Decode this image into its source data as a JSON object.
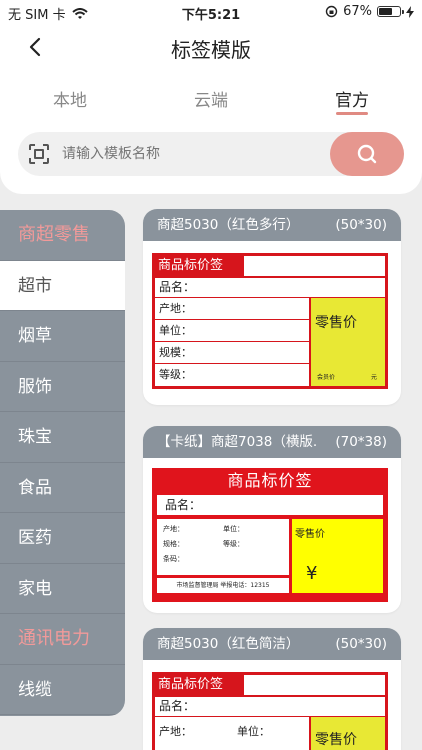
{
  "status_bar": {
    "carrier": "无 SIM 卡",
    "time": "下午5:21",
    "battery": "67%",
    "battery_level": 0.67
  },
  "header": {
    "title": "标签模版"
  },
  "tabs": [
    {
      "label": "本地",
      "active": false
    },
    {
      "label": "云端",
      "active": false
    },
    {
      "label": "官方",
      "active": true
    }
  ],
  "search": {
    "placeholder": "请输入模板名称"
  },
  "sidebar": {
    "items": [
      {
        "label": "商超零售",
        "type": "group"
      },
      {
        "label": "超市",
        "type": "item",
        "active": true
      },
      {
        "label": "烟草",
        "type": "item"
      },
      {
        "label": "服饰",
        "type": "item"
      },
      {
        "label": "珠宝",
        "type": "item"
      },
      {
        "label": "食品",
        "type": "item"
      },
      {
        "label": "医药",
        "type": "item"
      },
      {
        "label": "家电",
        "type": "item"
      },
      {
        "label": "通讯电力",
        "type": "group"
      },
      {
        "label": "线缆",
        "type": "item"
      }
    ]
  },
  "templates": [
    {
      "name": "商超5030（红色多行）",
      "size": "(50*30)",
      "label": {
        "title": "商品标价签",
        "name_field": "品名：",
        "fields": [
          "产地：",
          "单位：",
          "规模：",
          "等级："
        ],
        "price_title": "零售价",
        "member": "会员价",
        "unit": "元"
      }
    },
    {
      "name": "【卡纸】商超7038（横版.",
      "size": "(70*38)",
      "label": {
        "title": "商品标价签",
        "name_field": "品名：",
        "fields_left": [
          "产地：",
          "规格：",
          "条码："
        ],
        "fields_right": [
          "单位：",
          "等级："
        ],
        "price_title": "零售价",
        "currency": "¥",
        "footer": "市场监督管理局 举报电话：12315"
      }
    },
    {
      "name": "商超5030（红色简洁）",
      "size": "(50*30)",
      "label": {
        "title": "商品标价签",
        "name_field": "品名：",
        "place": "产地：",
        "unit": "单位：",
        "price_title": "零售价"
      }
    }
  ],
  "colors": {
    "accent": "#e6978f",
    "sidebar_bg": "#8a939c",
    "label_red": "#d6151c",
    "label_yellow": "#e8e834"
  }
}
